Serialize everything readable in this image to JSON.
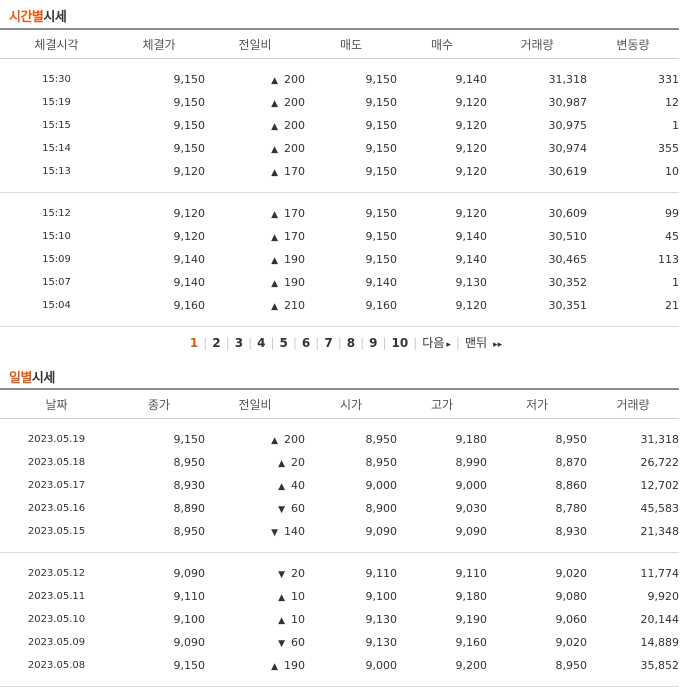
{
  "time_section": {
    "title_highlight": "시간별",
    "title_rest": "시세",
    "headers": [
      "체결시각",
      "체결가",
      "전일비",
      "매도",
      "매수",
      "거래량",
      "변동량"
    ],
    "groups": [
      [
        {
          "time": "15:30",
          "price": "9,150",
          "dir": "up",
          "diff": "200",
          "ask": "9,150",
          "bid": "9,140",
          "volume": "31,318",
          "change": "331"
        },
        {
          "time": "15:19",
          "price": "9,150",
          "dir": "up",
          "diff": "200",
          "ask": "9,150",
          "bid": "9,120",
          "volume": "30,987",
          "change": "12"
        },
        {
          "time": "15:15",
          "price": "9,150",
          "dir": "up",
          "diff": "200",
          "ask": "9,150",
          "bid": "9,120",
          "volume": "30,975",
          "change": "1"
        },
        {
          "time": "15:14",
          "price": "9,150",
          "dir": "up",
          "diff": "200",
          "ask": "9,150",
          "bid": "9,120",
          "volume": "30,974",
          "change": "355"
        },
        {
          "time": "15:13",
          "price": "9,120",
          "dir": "up",
          "diff": "170",
          "ask": "9,150",
          "bid": "9,120",
          "volume": "30,619",
          "change": "10"
        }
      ],
      [
        {
          "time": "15:12",
          "price": "9,120",
          "dir": "up",
          "diff": "170",
          "ask": "9,150",
          "bid": "9,120",
          "volume": "30,609",
          "change": "99"
        },
        {
          "time": "15:10",
          "price": "9,120",
          "dir": "up",
          "diff": "170",
          "ask": "9,150",
          "bid": "9,140",
          "volume": "30,510",
          "change": "45"
        },
        {
          "time": "15:09",
          "price": "9,140",
          "dir": "up",
          "diff": "190",
          "ask": "9,150",
          "bid": "9,140",
          "volume": "30,465",
          "change": "113"
        },
        {
          "time": "15:07",
          "price": "9,140",
          "dir": "up",
          "diff": "190",
          "ask": "9,140",
          "bid": "9,130",
          "volume": "30,352",
          "change": "1"
        },
        {
          "time": "15:04",
          "price": "9,160",
          "dir": "up",
          "diff": "210",
          "ask": "9,160",
          "bid": "9,120",
          "volume": "30,351",
          "change": "21"
        }
      ]
    ]
  },
  "pagination": {
    "pages": [
      "1",
      "2",
      "3",
      "4",
      "5",
      "6",
      "7",
      "8",
      "9",
      "10"
    ],
    "current": "1",
    "next_label": "다음",
    "last_label": "맨뒤",
    "next_icon": "▸",
    "last_icon": "▸▸"
  },
  "daily_section": {
    "title_highlight": "일별",
    "title_rest": "시세",
    "headers": [
      "날짜",
      "종가",
      "전일비",
      "시가",
      "고가",
      "저가",
      "거래량"
    ],
    "groups": [
      [
        {
          "date": "2023.05.19",
          "close": "9,150",
          "dir": "up",
          "diff": "200",
          "open": "8,950",
          "high": "9,180",
          "low": "8,950",
          "volume": "31,318"
        },
        {
          "date": "2023.05.18",
          "close": "8,950",
          "dir": "up",
          "diff": "20",
          "open": "8,950",
          "high": "8,990",
          "low": "8,870",
          "volume": "26,722"
        },
        {
          "date": "2023.05.17",
          "close": "8,930",
          "dir": "up",
          "diff": "40",
          "open": "9,000",
          "high": "9,000",
          "low": "8,860",
          "volume": "12,702"
        },
        {
          "date": "2023.05.16",
          "close": "8,890",
          "dir": "down",
          "diff": "60",
          "open": "8,900",
          "high": "9,030",
          "low": "8,780",
          "volume": "45,583"
        },
        {
          "date": "2023.05.15",
          "close": "8,950",
          "dir": "down",
          "diff": "140",
          "open": "9,090",
          "high": "9,090",
          "low": "8,930",
          "volume": "21,348"
        }
      ],
      [
        {
          "date": "2023.05.12",
          "close": "9,090",
          "dir": "down",
          "diff": "20",
          "open": "9,110",
          "high": "9,110",
          "low": "9,020",
          "volume": "11,774"
        },
        {
          "date": "2023.05.11",
          "close": "9,110",
          "dir": "up",
          "diff": "10",
          "open": "9,100",
          "high": "9,180",
          "low": "9,080",
          "volume": "9,920"
        },
        {
          "date": "2023.05.10",
          "close": "9,100",
          "dir": "up",
          "diff": "10",
          "open": "9,130",
          "high": "9,190",
          "low": "9,060",
          "volume": "20,144"
        },
        {
          "date": "2023.05.09",
          "close": "9,090",
          "dir": "down",
          "diff": "60",
          "open": "9,130",
          "high": "9,160",
          "low": "9,020",
          "volume": "14,889"
        },
        {
          "date": "2023.05.08",
          "close": "9,150",
          "dir": "up",
          "diff": "190",
          "open": "9,000",
          "high": "9,200",
          "low": "8,950",
          "volume": "35,852"
        }
      ]
    ]
  },
  "icons": {
    "up": "▲",
    "down": "▼"
  },
  "colors": {
    "accent": "#e8590c",
    "up": "#d40000",
    "down": "#1a5fd1"
  }
}
